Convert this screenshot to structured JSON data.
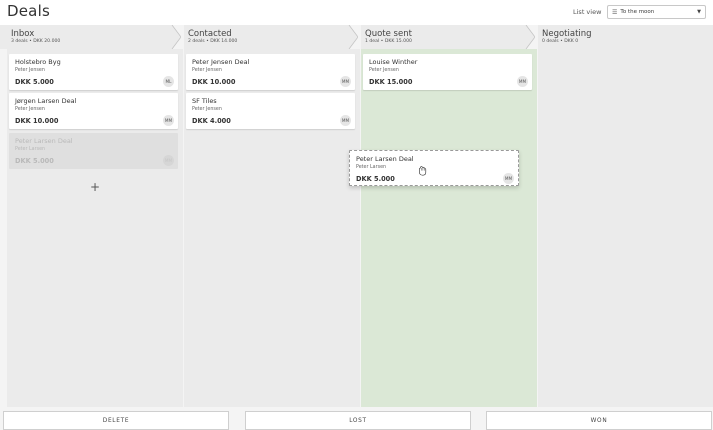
{
  "header": {
    "title": "Deals",
    "list_view_label": "List view",
    "pipeline_selected": "To the moon"
  },
  "stages": [
    {
      "name": "Inbox",
      "summary": "3 deals • DKK 20.000"
    },
    {
      "name": "Contacted",
      "summary": "2 deals • DKK 14.000"
    },
    {
      "name": "Quote sent",
      "summary": "1 deal • DKK 15.000"
    },
    {
      "name": "Negotiating",
      "summary": "0 deals • DKK 0"
    }
  ],
  "cards": {
    "inbox": [
      {
        "title": "Holstebro Byg",
        "person": "Peter Jensen",
        "value": "DKK 5.000",
        "owner": "ML"
      },
      {
        "title": "Jørgen Larsen Deal",
        "person": "Peter Jensen",
        "value": "DKK 10.000",
        "owner": "MM"
      },
      {
        "title": "Peter Larsen Deal",
        "person": "Peter Larsen",
        "value": "DKK 5.000",
        "owner": "MM"
      }
    ],
    "contacted": [
      {
        "title": "Peter Jensen Deal",
        "person": "Peter Jensen",
        "value": "DKK 10.000",
        "owner": "MM"
      },
      {
        "title": "SF Tiles",
        "person": "Peter Jensen",
        "value": "DKK 4.000",
        "owner": "MM"
      }
    ],
    "quote": [
      {
        "title": "Louise Winther",
        "person": "Peter Jensen",
        "value": "DKK 15.000",
        "owner": "MM"
      }
    ],
    "dragging": {
      "title": "Peter Larsen Deal",
      "person": "Peter Larsen",
      "value": "DKK 5.000",
      "owner": "MM"
    }
  },
  "add_label": "+",
  "drop_zones": {
    "delete": "DELETE",
    "lost": "LOST",
    "won": "WON"
  },
  "icons": {
    "pipeline": "pipeline-icon",
    "caret": "caret-down-icon",
    "cursor": "grab-hand-icon"
  }
}
